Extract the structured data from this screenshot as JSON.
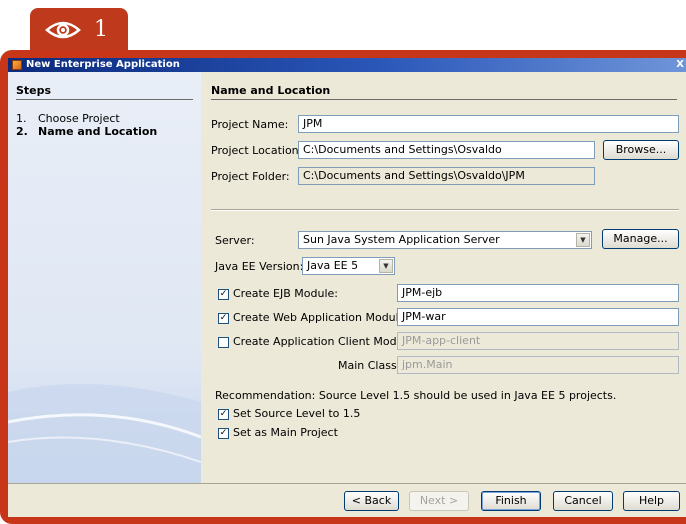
{
  "badge": {
    "icon": "eye-icon",
    "number": "1",
    "color": "#bf3a1d"
  },
  "window": {
    "title": "New Enterprise Application",
    "close_glyph": "X"
  },
  "steps": {
    "heading": "Steps",
    "items": [
      {
        "num": "1.",
        "label": "Choose Project",
        "current": false
      },
      {
        "num": "2.",
        "label": "Name and Location",
        "current": true
      }
    ]
  },
  "panel": {
    "heading": "Name and Location",
    "project_name": {
      "label": "Project Name:",
      "value": "JPM"
    },
    "project_location": {
      "label": "Project Location:",
      "value": "C:\\Documents and Settings\\Osvaldo",
      "browse": "Browse..."
    },
    "project_folder": {
      "label": "Project Folder:",
      "value": "C:\\Documents and Settings\\Osvaldo\\JPM"
    },
    "server": {
      "label": "Server:",
      "value": "Sun Java System Application Server",
      "manage": "Manage..."
    },
    "javaee": {
      "label": "Java EE Version:",
      "value": "Java EE 5"
    },
    "ejb_module": {
      "label": "Create EJB Module:",
      "value": "JPM-ejb",
      "checked": true
    },
    "web_module": {
      "label": "Create Web Application Module:",
      "value": "JPM-war",
      "checked": true
    },
    "client_module": {
      "label": "Create Application Client Module:",
      "value": "JPM-app-client",
      "checked": false
    },
    "main_class": {
      "label": "Main Class:",
      "value": "jpm.Main"
    },
    "recommendation": "Recommendation: Source Level 1.5 should be used in Java EE 5 projects.",
    "source_level": {
      "label": "Set Source Level to 1.5",
      "checked": true
    },
    "main_project": {
      "label": "Set as Main Project",
      "checked": true
    }
  },
  "footer": {
    "back": "< Back",
    "next": "Next >",
    "finish": "Finish",
    "cancel": "Cancel",
    "help": "Help"
  },
  "colors": {
    "accent": "#c8361a",
    "title_bar": "#0b2a7c",
    "dialog_bg": "#ece9d8"
  }
}
